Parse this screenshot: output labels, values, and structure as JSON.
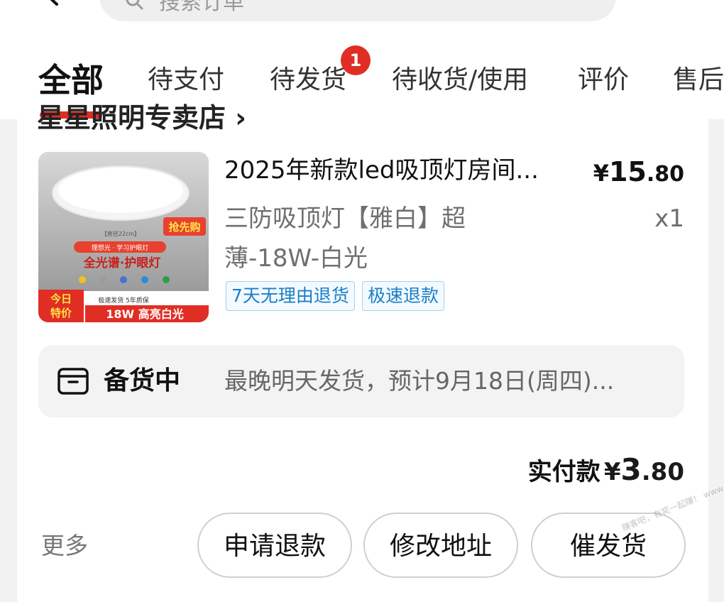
{
  "header": {
    "search_placeholder": "搜索订单"
  },
  "tabs": [
    {
      "label": "全部",
      "active": true
    },
    {
      "label": "待支付"
    },
    {
      "label": "待发货",
      "badge": "1"
    },
    {
      "label": "待收货/使用"
    },
    {
      "label": "评价"
    },
    {
      "label": "售后"
    }
  ],
  "order": {
    "shop_name": "星星照明专卖店 ›",
    "product": {
      "title": "2025年新款led吸顶灯房间...",
      "price": {
        "currency": "¥",
        "integer": "15",
        "decimal": ".80"
      },
      "spec": "三防吸顶灯【雅白】超薄-18W-白光",
      "quantity": "x1",
      "tags": [
        "7天无理由退货",
        "极速退款"
      ],
      "image": {
        "badge_text": "抢先购",
        "size_text": "【直径22cm】",
        "feature_line": "理想光 · 学习护眼灯",
        "headline": "全光谱·护眼灯",
        "banner_left_line1": "今日",
        "banner_left_line2": "特价",
        "banner_top": "极速发货  5年质保",
        "banner_main": "18W 高亮白光"
      }
    },
    "status": {
      "icon": "package-box-icon",
      "label": "备货中",
      "text": "最晚明天发货，预计9月18日(周四)..."
    },
    "paid": {
      "label": "实付款",
      "currency": "¥",
      "integer": "3",
      "decimal": ".80"
    },
    "actions": {
      "more": "更多",
      "refund": "申请退款",
      "change_address": "修改地址",
      "urge": "催发货"
    }
  },
  "watermark": "赚客吧，有奖一起赚！ www.zuanke8.com",
  "colors": {
    "accent": "#e02e24",
    "tag_blue": "#1a7fc7"
  }
}
